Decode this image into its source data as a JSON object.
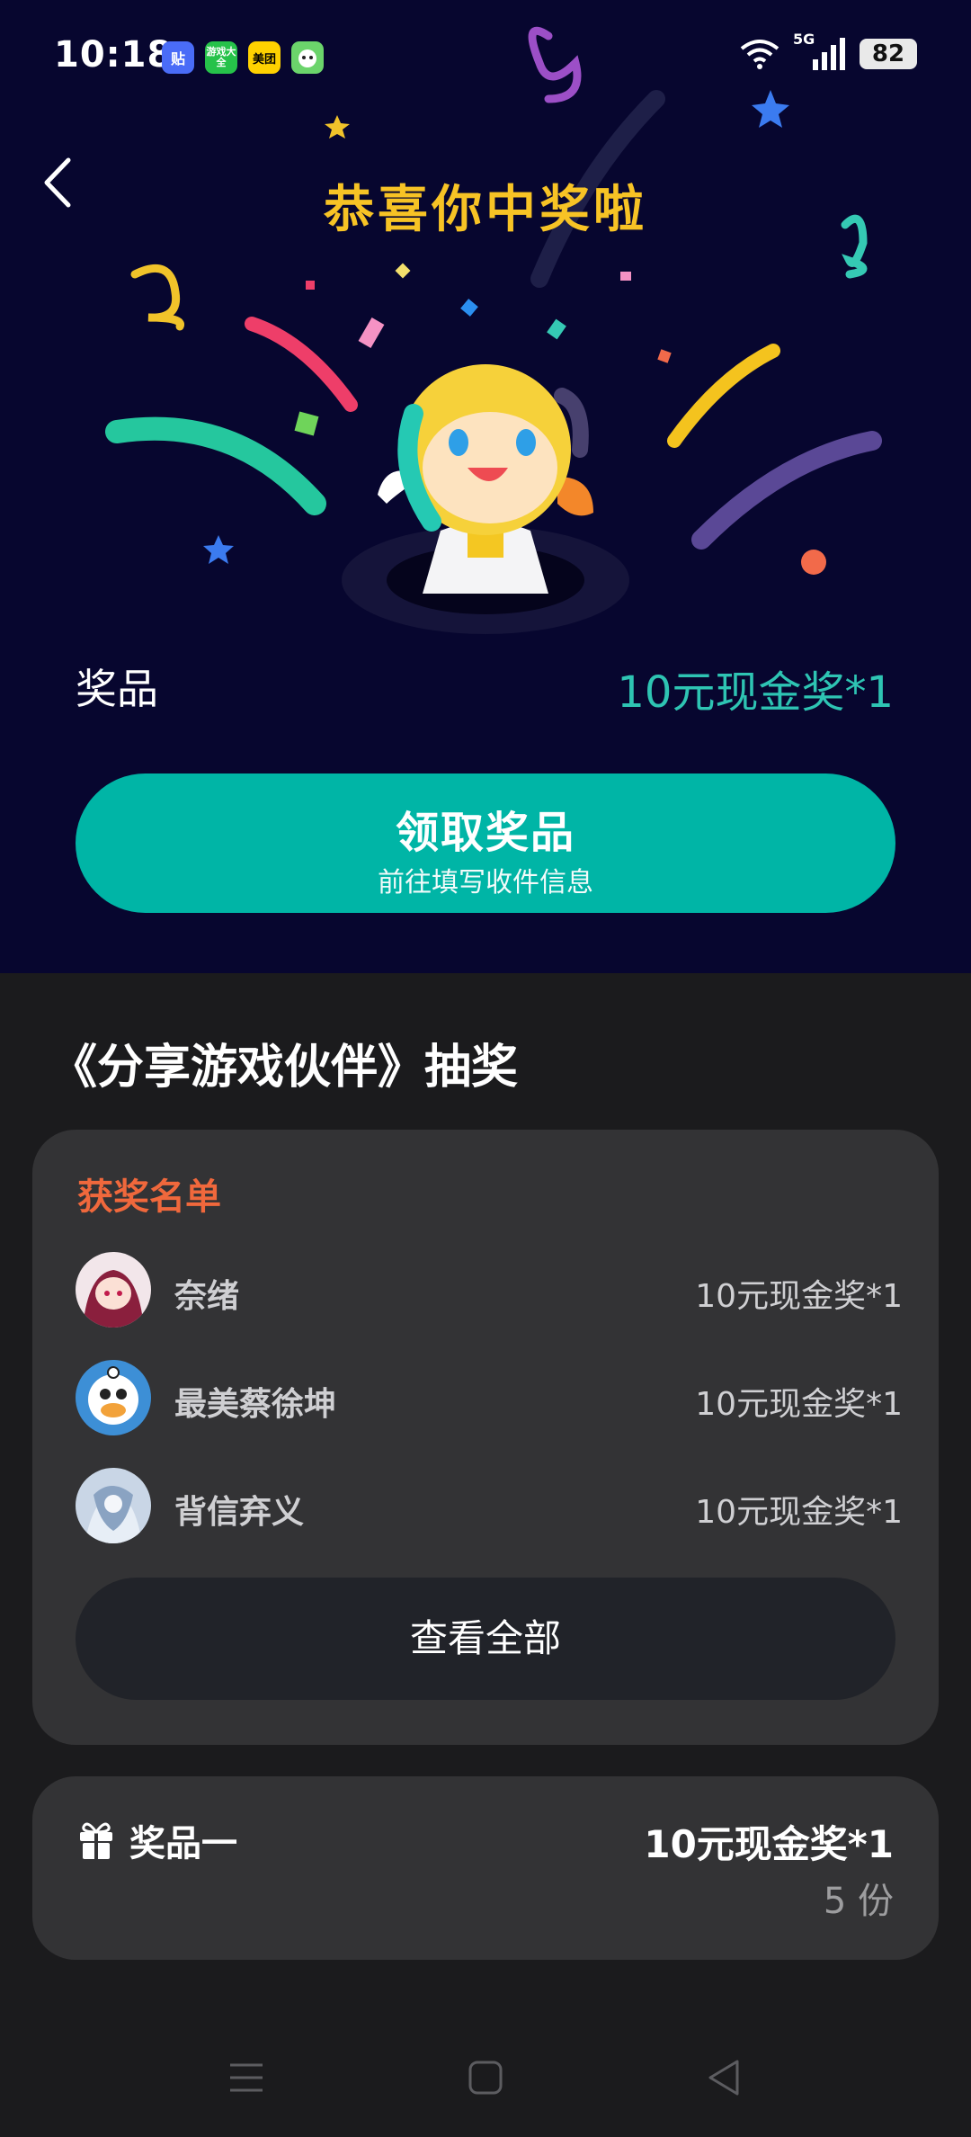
{
  "status_bar": {
    "time": "10:18",
    "app_icons": [
      {
        "label": "贴",
        "color": "#4a6cf7"
      },
      {
        "label": "游戏大全",
        "color": "#26c24a"
      },
      {
        "label": "美团",
        "color": "#ffd100"
      },
      {
        "label": "",
        "color": "#6bd46b"
      }
    ],
    "network": "5G",
    "battery": "82"
  },
  "hero": {
    "title": "恭喜你中奖啦",
    "prize_label": "奖品",
    "prize_value": "10元现金奖*1",
    "claim_button": {
      "label": "领取奖品",
      "sublabel": "前往填写收件信息"
    }
  },
  "lottery": {
    "title": "《分享游戏伙伴》抽奖",
    "winners": {
      "heading": "获奖名单",
      "rows": [
        {
          "name": "奈绪",
          "prize": "10元现金奖*1"
        },
        {
          "name": "最美蔡徐坤",
          "prize": "10元现金奖*1"
        },
        {
          "name": "背信弃义",
          "prize": "10元现金奖*1"
        }
      ],
      "view_all": "查看全部"
    },
    "prize_item": {
      "name": "奖品一",
      "value": "10元现金奖*1",
      "count": "5 份"
    }
  },
  "colors": {
    "hero_bg": "#07062f",
    "accent_teal": "#00b5a6",
    "title_yellow": "#f7c325",
    "winners_orange": "#f0683c"
  }
}
